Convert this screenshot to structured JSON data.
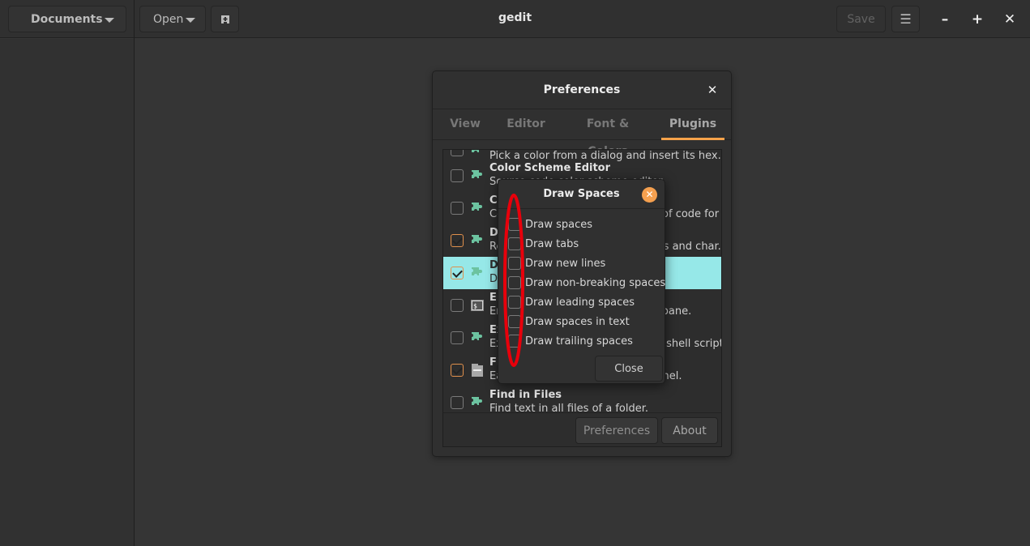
{
  "window": {
    "title": "gedit",
    "documents_label": "Documents",
    "open_label": "Open",
    "save_label": "Save",
    "icons": {
      "new_tab": "new-tab-icon",
      "menu": "hamburger-menu-icon",
      "minimize": "minimize-icon",
      "maximize": "maximize-icon",
      "close": "close-icon"
    }
  },
  "preferences": {
    "title": "Preferences",
    "tabs": [
      {
        "label": "View",
        "active": false
      },
      {
        "label": "Editor",
        "active": false
      },
      {
        "label": "Font & Colors",
        "active": false
      },
      {
        "label": "Plugins",
        "active": true
      }
    ],
    "plugins": [
      {
        "name": "",
        "description": "Pick a color from a dialog and insert its hex...",
        "enabled": false,
        "icon": "puzzle-icon",
        "partial": true
      },
      {
        "name": "Color Scheme Editor",
        "description": "Source code color scheme editor",
        "enabled": false,
        "icon": "puzzle-icon"
      },
      {
        "name": "Code Comment",
        "description": "Comment or uncomment blocks of code for advanced editing",
        "enabled": false,
        "icon": "puzzle-icon"
      },
      {
        "name": "Document Statistics",
        "description": "Report the number of words, lines and char...",
        "enabled": true,
        "icon": "puzzle-icon"
      },
      {
        "name": "Draw Spaces",
        "description": "Draw spaces and tabs",
        "enabled": true,
        "selected": true,
        "icon": "puzzle-icon"
      },
      {
        "name": "Embedded Terminal",
        "description": "Embed a terminal in the bottom pane.",
        "enabled": false,
        "icon": "terminal-icon"
      },
      {
        "name": "External Tools",
        "description": "Execute external commands and shell scripts.",
        "enabled": false,
        "icon": "puzzle-icon"
      },
      {
        "name": "File Browser Panel",
        "description": "Easy file access from the side panel.",
        "enabled": true,
        "icon": "file-cabinet-icon"
      },
      {
        "name": "Find in Files",
        "description": "Find text in all files of a folder.",
        "enabled": false,
        "icon": "puzzle-icon"
      }
    ],
    "buttons": {
      "preferences": "Preferences",
      "about": "About"
    }
  },
  "draw_spaces": {
    "title": "Draw Spaces",
    "options": [
      {
        "label": "Draw spaces",
        "checked": false
      },
      {
        "label": "Draw tabs",
        "checked": false
      },
      {
        "label": "Draw new lines",
        "checked": false
      },
      {
        "label": "Draw non-breaking spaces",
        "checked": false
      },
      {
        "label": "Draw leading spaces",
        "checked": false
      },
      {
        "label": "Draw spaces in text",
        "checked": false
      },
      {
        "label": "Draw trailing spaces",
        "checked": false
      }
    ],
    "close_label": "Close"
  },
  "colors": {
    "accent": "#f6a24a",
    "selection": "#96e8e8",
    "annotation": "#e8000b",
    "plugin_icon": "#6cc3a0"
  }
}
